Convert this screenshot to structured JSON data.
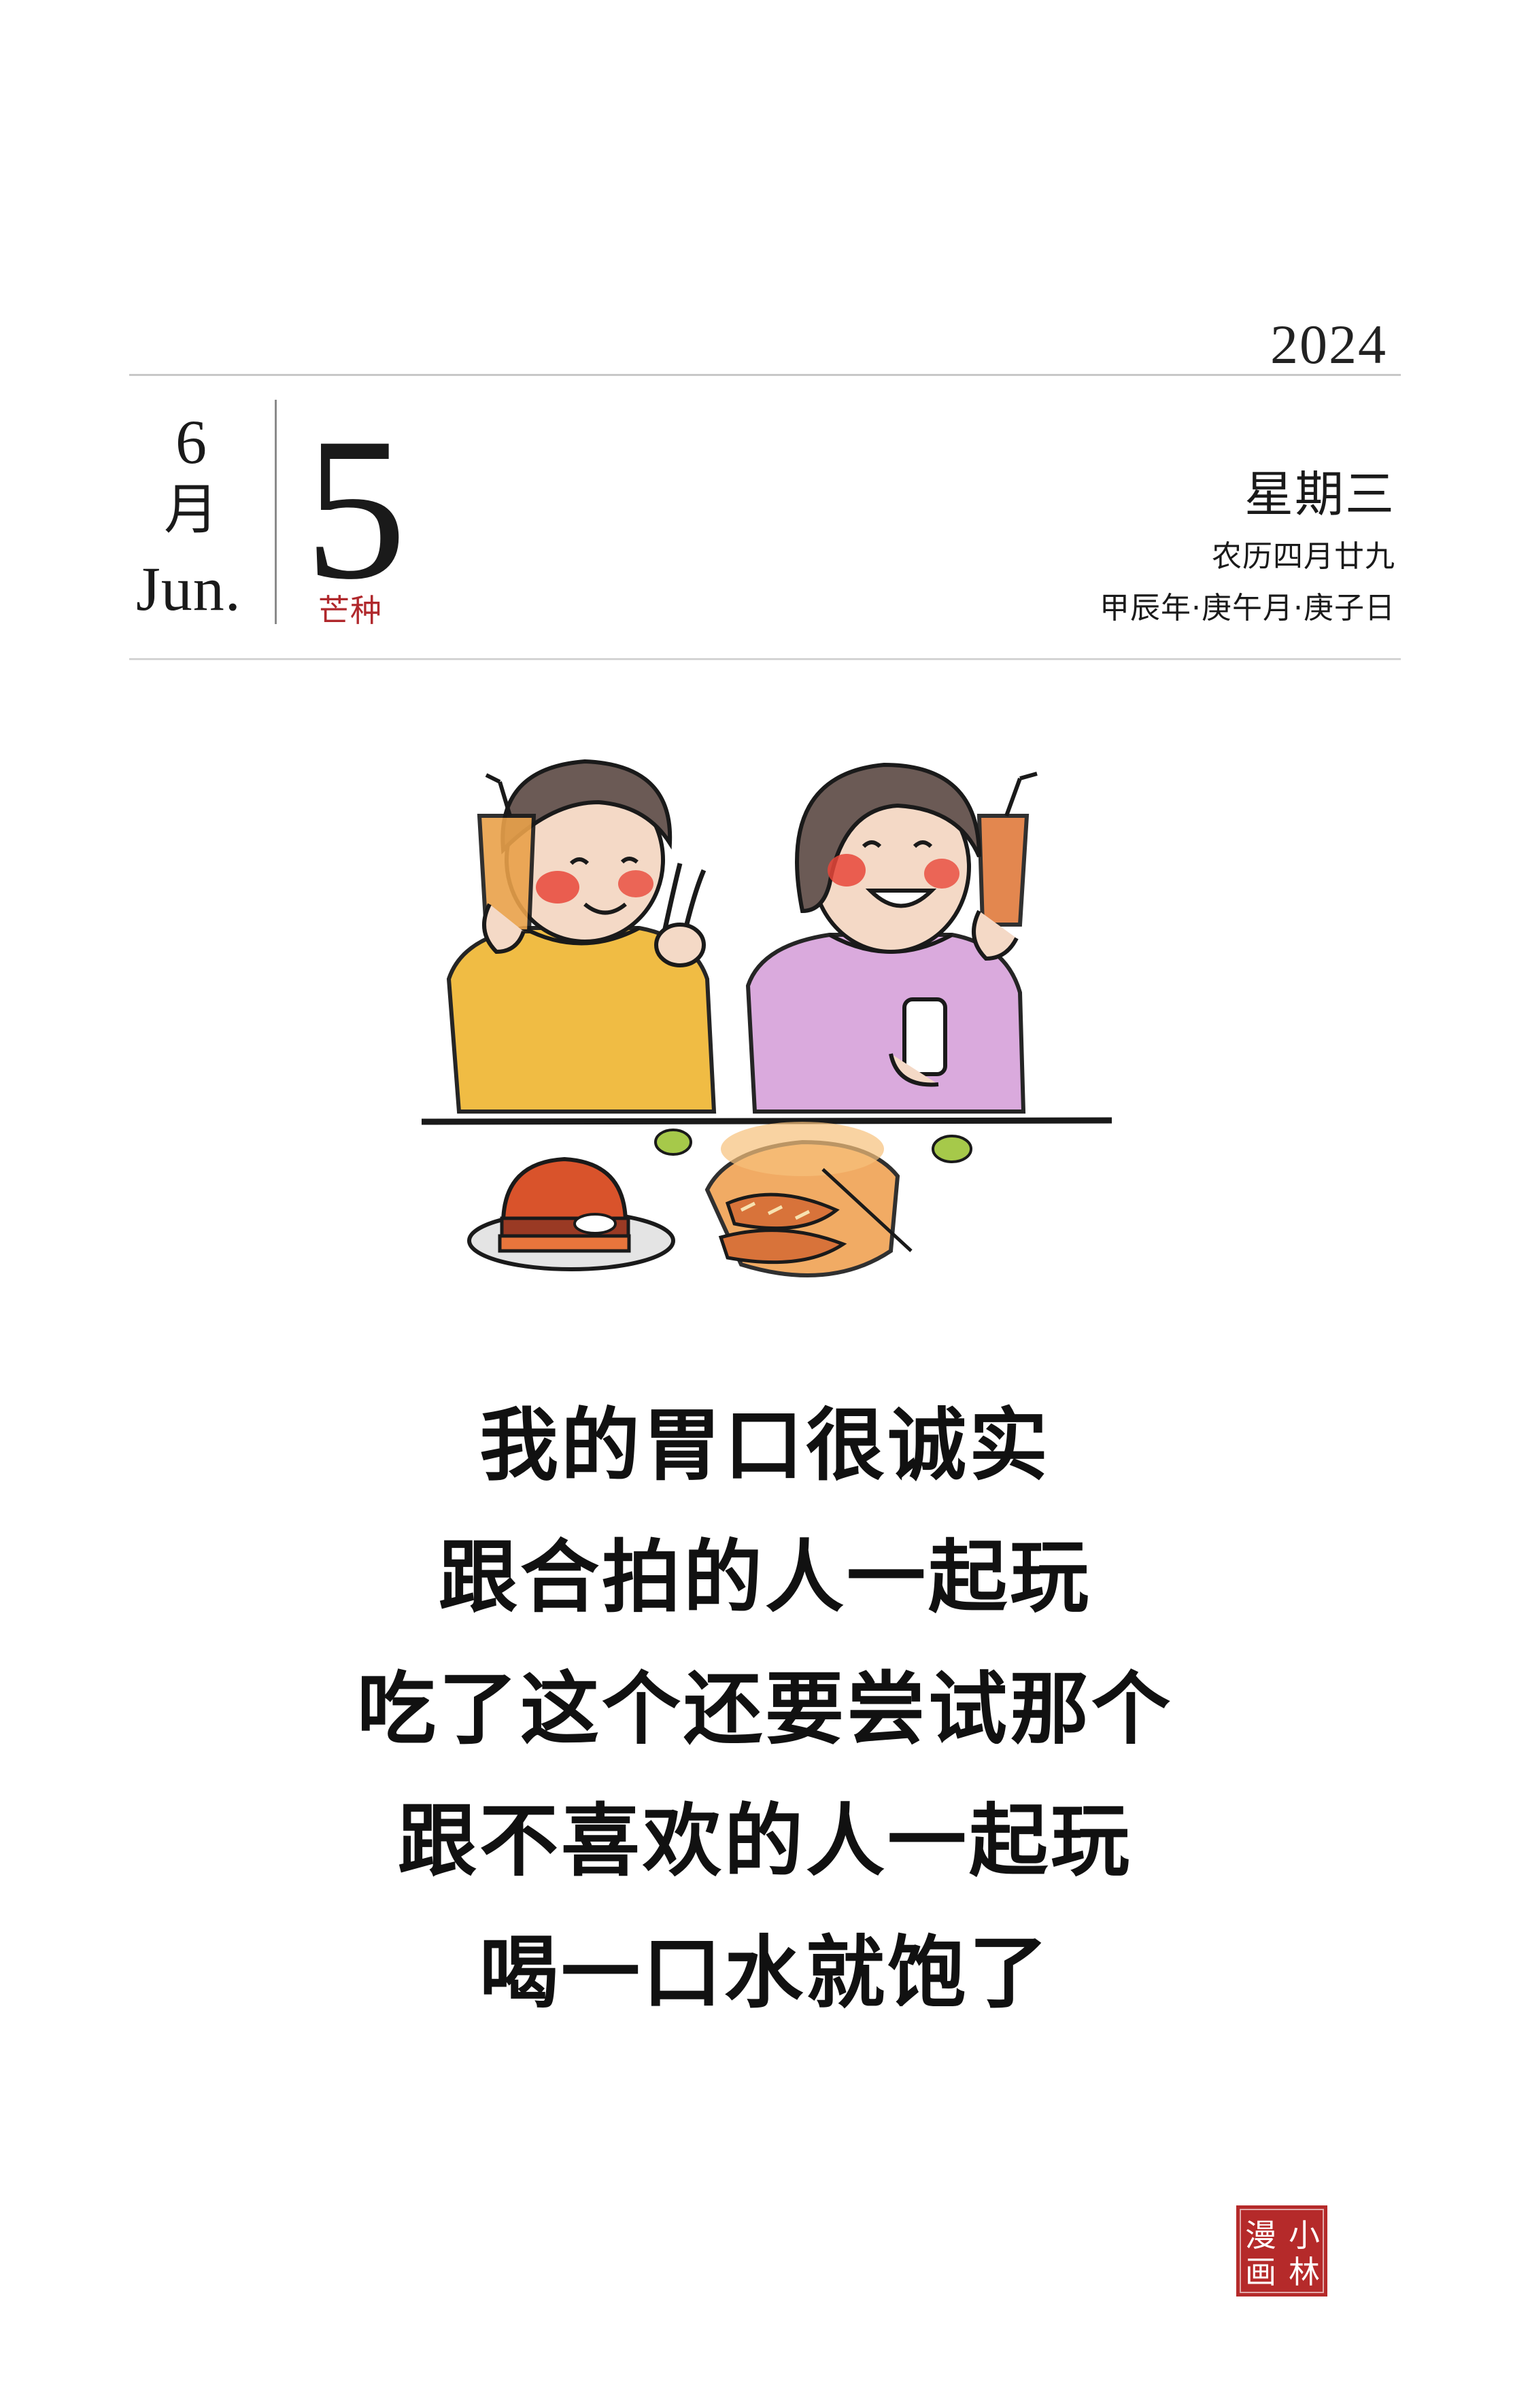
{
  "header": {
    "year": "2024",
    "month_number": "6",
    "month_cn": "月",
    "month_en": "Jun.",
    "day": "5",
    "solar_term": "芒种",
    "weekday": "星期三",
    "lunar_date": "农历四月廿九",
    "ganzhi": "甲辰年·庚午月·庚子日"
  },
  "illustration": {
    "icon": "two-friends-eating-illustration"
  },
  "poem": {
    "lines": [
      "我的胃口很诚实",
      "跟合拍的人一起玩",
      "吃了这个还要尝试那个",
      "跟不喜欢的人一起玩",
      "喝一口水就饱了"
    ]
  },
  "seal": {
    "text": "小林漫画",
    "color": "#b52a2a"
  },
  "colors": {
    "accent_red": "#b0282c",
    "rule_gray": "#c8c8c8"
  }
}
